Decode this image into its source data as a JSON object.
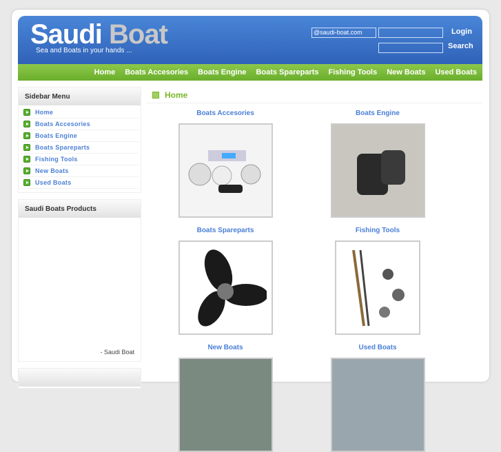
{
  "header": {
    "logo_main": "Saudi",
    "logo_accent": "Boat",
    "tagline": "Sea and Boats in your hands ...",
    "email_value": "@saudi-boat.com",
    "login_label": "Login",
    "search_label": "Search"
  },
  "nav": [
    "Home",
    "Boats Accesories",
    "Boats Engine",
    "Boats Spareparts",
    "Fishing Tools",
    "New Boats",
    "Used Boats"
  ],
  "sidebar": {
    "menu_title": "Sidebar Menu",
    "items": [
      "Home",
      "Boats Accesories",
      "Boats Engine",
      "Boats Spareparts",
      "Fishing Tools",
      "New Boats",
      "Used Boats"
    ],
    "products_title": "Saudi Boats Products",
    "products_caption": "- Saudi Boat"
  },
  "main": {
    "title": "Home",
    "categories": [
      "Boats Accesories",
      "Boats Engine",
      "Boats Spareparts",
      "Fishing Tools",
      "New Boats",
      "Used Boats"
    ]
  }
}
